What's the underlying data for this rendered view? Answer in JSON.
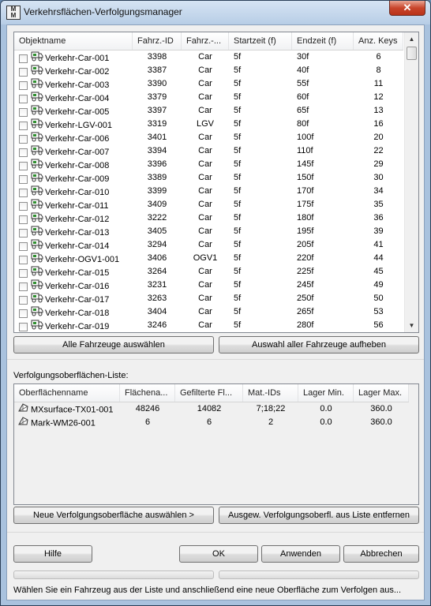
{
  "window": {
    "title": "Verkehrsflächen-Verfolgungsmanager",
    "app_icon_top": "M",
    "app_icon_bottom": "M",
    "close_glyph": "✕"
  },
  "vehicle_list": {
    "columns": [
      "Objektname",
      "Fahrz.-ID",
      "Fahrz.-...",
      "Startzeit (f)",
      "Endzeit (f)",
      "Anz. Keys"
    ],
    "rows": [
      {
        "name": "Verkehr-Car-001",
        "id": "3398",
        "type": "Car",
        "start": "5f",
        "end": "30f",
        "keys": "6"
      },
      {
        "name": "Verkehr-Car-002",
        "id": "3387",
        "type": "Car",
        "start": "5f",
        "end": "40f",
        "keys": "8"
      },
      {
        "name": "Verkehr-Car-003",
        "id": "3390",
        "type": "Car",
        "start": "5f",
        "end": "55f",
        "keys": "11"
      },
      {
        "name": "Verkehr-Car-004",
        "id": "3379",
        "type": "Car",
        "start": "5f",
        "end": "60f",
        "keys": "12"
      },
      {
        "name": "Verkehr-Car-005",
        "id": "3397",
        "type": "Car",
        "start": "5f",
        "end": "65f",
        "keys": "13"
      },
      {
        "name": "Verkehr-LGV-001",
        "id": "3319",
        "type": "LGV",
        "start": "5f",
        "end": "80f",
        "keys": "16"
      },
      {
        "name": "Verkehr-Car-006",
        "id": "3401",
        "type": "Car",
        "start": "5f",
        "end": "100f",
        "keys": "20"
      },
      {
        "name": "Verkehr-Car-007",
        "id": "3394",
        "type": "Car",
        "start": "5f",
        "end": "110f",
        "keys": "22"
      },
      {
        "name": "Verkehr-Car-008",
        "id": "3396",
        "type": "Car",
        "start": "5f",
        "end": "145f",
        "keys": "29"
      },
      {
        "name": "Verkehr-Car-009",
        "id": "3389",
        "type": "Car",
        "start": "5f",
        "end": "150f",
        "keys": "30"
      },
      {
        "name": "Verkehr-Car-010",
        "id": "3399",
        "type": "Car",
        "start": "5f",
        "end": "170f",
        "keys": "34"
      },
      {
        "name": "Verkehr-Car-011",
        "id": "3409",
        "type": "Car",
        "start": "5f",
        "end": "175f",
        "keys": "35"
      },
      {
        "name": "Verkehr-Car-012",
        "id": "3222",
        "type": "Car",
        "start": "5f",
        "end": "180f",
        "keys": "36"
      },
      {
        "name": "Verkehr-Car-013",
        "id": "3405",
        "type": "Car",
        "start": "5f",
        "end": "195f",
        "keys": "39"
      },
      {
        "name": "Verkehr-Car-014",
        "id": "3294",
        "type": "Car",
        "start": "5f",
        "end": "205f",
        "keys": "41"
      },
      {
        "name": "Verkehr-OGV1-001",
        "id": "3406",
        "type": "OGV1",
        "start": "5f",
        "end": "220f",
        "keys": "44"
      },
      {
        "name": "Verkehr-Car-015",
        "id": "3264",
        "type": "Car",
        "start": "5f",
        "end": "225f",
        "keys": "45"
      },
      {
        "name": "Verkehr-Car-016",
        "id": "3231",
        "type": "Car",
        "start": "5f",
        "end": "245f",
        "keys": "49"
      },
      {
        "name": "Verkehr-Car-017",
        "id": "3263",
        "type": "Car",
        "start": "5f",
        "end": "250f",
        "keys": "50"
      },
      {
        "name": "Verkehr-Car-018",
        "id": "3404",
        "type": "Car",
        "start": "5f",
        "end": "265f",
        "keys": "53"
      },
      {
        "name": "Verkehr-Car-019",
        "id": "3246",
        "type": "Car",
        "start": "5f",
        "end": "280f",
        "keys": "56"
      }
    ],
    "scroll_up": "▲",
    "scroll_down": "▼"
  },
  "buttons": {
    "select_all": "Alle Fahrzeuge auswählen",
    "deselect_all": "Auswahl aller Fahrzeuge aufheben",
    "add_surface": "Neue Verfolgungsoberfläche auswählen >",
    "remove_surface": "Ausgew. Verfolgungsoberfl. aus Liste entfernen",
    "help": "Hilfe",
    "ok": "OK",
    "apply": "Anwenden",
    "cancel": "Abbrechen"
  },
  "surface_section": {
    "label": "Verfolgungsoberflächen-Liste:",
    "columns": [
      "Oberflächenname",
      "Flächena...",
      "Gefilterte Fl...",
      "Mat.-IDs",
      "Lager Min.",
      "Lager Max."
    ],
    "rows": [
      {
        "name": "MXsurface-TX01-001",
        "faces": "48246",
        "filtered": "14082",
        "mat_ids": "7;18;22",
        "min": "0.0",
        "max": "360.0"
      },
      {
        "name": "Mark-WM26-001",
        "faces": "6",
        "filtered": "6",
        "mat_ids": "2",
        "min": "0.0",
        "max": "360.0"
      }
    ]
  },
  "status_text": "Wählen Sie ein Fahrzeug aus der Liste und anschließend eine neue Oberfläche zum Verfolgen aus..."
}
